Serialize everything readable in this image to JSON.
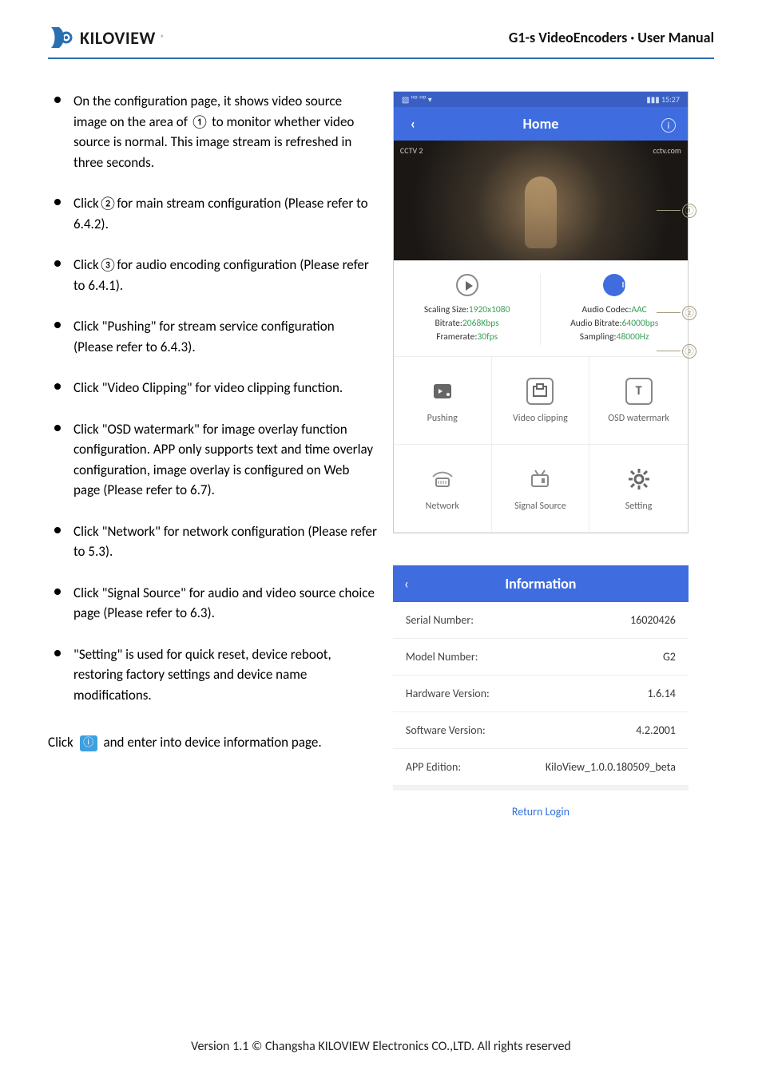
{
  "header": {
    "brand": "KILOVIEW",
    "title": "G1-s VideoEncoders · User Manual"
  },
  "bullets": [
    "On the configuration page, it shows video source image on the area of ① to monitor whether video source is normal. This image stream is refreshed in three seconds.",
    "Click②for main stream configuration (Please refer to 6.4.2).",
    "Click③for audio encoding configuration (Please refer to 6.4.1).",
    "Click \"Pushing\" for stream service configuration (Please refer to 6.4.3).",
    "Click \"Video Clipping\" for video clipping function.",
    "Click \"OSD watermark\" for image overlay function configuration. APP only supports text and time overlay configuration, image overlay is configured on Web page (Please refer to 6.7).",
    "Click \"Network\" for network configuration (Please refer to 5.3).",
    "Click \"Signal Source\" for audio and video source choice page (Please refer to 6.3).",
    "\"Setting\" is used for quick reset, device reboot, restoring factory settings and device name modifications."
  ],
  "info_click_pre": "Click",
  "info_click_post": " and enter into device information page.",
  "phone": {
    "status_left": "▧ ᴴᴰ ᴴᴰ ▾",
    "status_right": "▮▮▮ 15:27",
    "nav_title": "Home",
    "preview_tl": "CCTV 2",
    "preview_tr": "cctv.com",
    "video_params": {
      "scaling_k": "Scaling Size:",
      "scaling_v": "1920x1080",
      "bitrate_k": "Bitrate:",
      "bitrate_v": "2068Kbps",
      "fps_k": "Framerate:",
      "fps_v": "30fps"
    },
    "audio_params": {
      "codec_k": "Audio Codec:",
      "codec_v": "AAC",
      "abitrate_k": "Audio Bitrate:",
      "abitrate_v": "64000bps",
      "sampling_k": "Sampling:",
      "sampling_v": "48000Hz"
    },
    "cells": [
      "Pushing",
      "Video clipping",
      "OSD watermark",
      "Network",
      "Signal Source",
      "Setting"
    ]
  },
  "callouts": {
    "c1": "①",
    "c2": "②",
    "c3": "③"
  },
  "info_panel": {
    "title": "Information",
    "rows": [
      {
        "k": "Serial Number:",
        "v": "16020426"
      },
      {
        "k": "Model Number:",
        "v": "G2"
      },
      {
        "k": "Hardware Version:",
        "v": "1.6.14"
      },
      {
        "k": "Software Version:",
        "v": "4.2.2001"
      },
      {
        "k": "APP Edition:",
        "v": "KiloView_1.0.0.180509_beta"
      }
    ],
    "return": "Return Login"
  },
  "footer": "Version 1.1 © Changsha KILOVIEW Electronics CO.,LTD. All rights reserved"
}
